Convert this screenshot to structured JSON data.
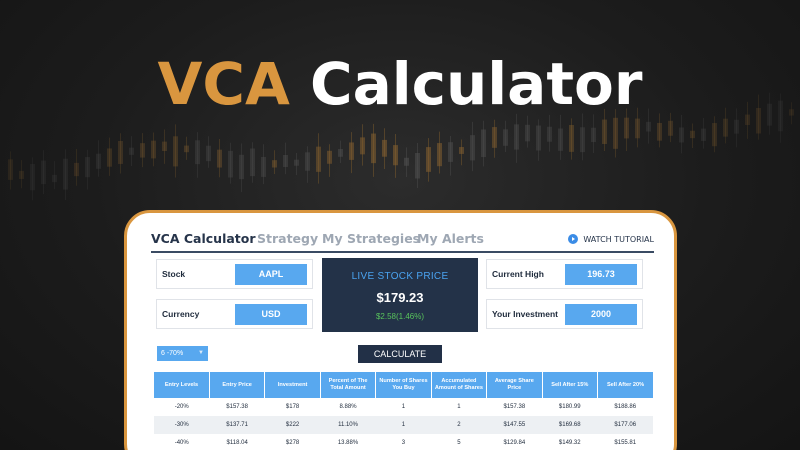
{
  "hero": {
    "title_accent": "VCA",
    "title_rest": "Calculator"
  },
  "colors": {
    "accent": "#d9963f",
    "primary_blue": "#58a8ef",
    "navy": "#233248",
    "gain_green": "#58c35c"
  },
  "tabs": [
    {
      "label": "VCA Calculator",
      "active": true
    },
    {
      "label": "Strategy",
      "active": false
    },
    {
      "label": "My Strategies",
      "active": false
    },
    {
      "label": "My Alerts",
      "active": false
    }
  ],
  "watch_tutorial": {
    "label": "WATCH TUTORIAL",
    "icon": "play-icon"
  },
  "fields": {
    "stock": {
      "label": "Stock",
      "value": "AAPL"
    },
    "currency": {
      "label": "Currency",
      "value": "USD"
    },
    "current_high": {
      "label": "Current High",
      "value": "196.73"
    },
    "investment": {
      "label": "Your Investment",
      "value": "2000"
    }
  },
  "live": {
    "title": "LIVE STOCK PRICE",
    "price": "$179.23",
    "change": "$2.58(1.46%)"
  },
  "range_select": {
    "value": "6 -70%"
  },
  "calculate_label": "CALCULATE",
  "table": {
    "headers": [
      "Entry Levels",
      "Entry Price",
      "Investment",
      "Percent of The Total Amount",
      "Number of Shares You Buy",
      "Accumulated Amount of Shares",
      "Average Share Price",
      "Sell After 15%",
      "Sell After 20%"
    ],
    "rows": [
      [
        "-20%",
        "$157.38",
        "$178",
        "8.88%",
        "1",
        "1",
        "$157.38",
        "$180.99",
        "$188.86"
      ],
      [
        "-30%",
        "$137.71",
        "$222",
        "11.10%",
        "1",
        "2",
        "$147.55",
        "$169.68",
        "$177.06"
      ],
      [
        "-40%",
        "$118.04",
        "$278",
        "13.88%",
        "3",
        "5",
        "$129.84",
        "$149.32",
        "$155.81"
      ]
    ]
  }
}
